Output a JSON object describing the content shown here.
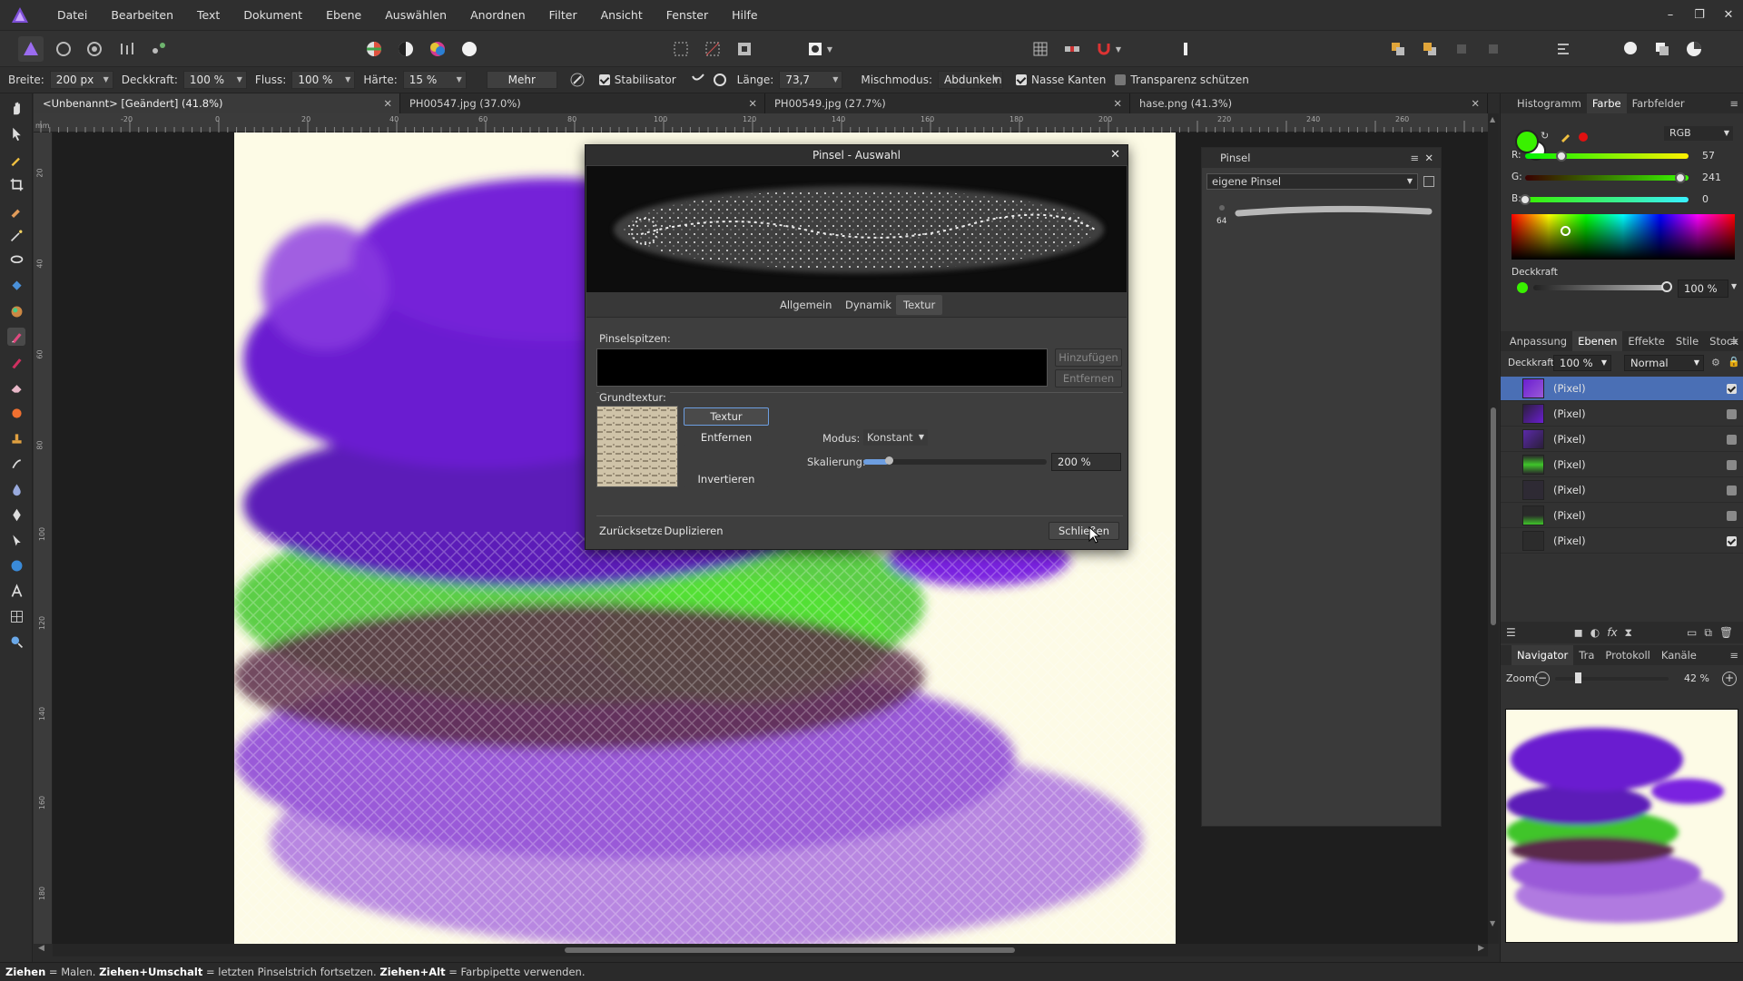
{
  "menu": [
    "Datei",
    "Bearbeiten",
    "Text",
    "Dokument",
    "Ebene",
    "Auswählen",
    "Anordnen",
    "Filter",
    "Ansicht",
    "Fenster",
    "Hilfe"
  ],
  "context": {
    "width_label": "Breite:",
    "width_value": "200 px",
    "opacity_label": "Deckkraft:",
    "opacity_value": "100 %",
    "flow_label": "Fluss:",
    "flow_value": "100 %",
    "hardness_label": "Härte:",
    "hardness_value": "15 %",
    "more": "Mehr",
    "stabilizer": "Stabilisator",
    "length_label": "Länge:",
    "length_value": "73,7",
    "blend_label": "Mischmodus:",
    "blend_value": "Abdunkeln",
    "wet_edges": "Nasse Kanten",
    "protect_alpha": "Transparenz schützen"
  },
  "tabs": [
    {
      "label": "<Unbenannt> [Geändert] (41.8%)"
    },
    {
      "label": "PH00547.jpg (37.0%)"
    },
    {
      "label": "PH00549.jpg (27.7%)"
    },
    {
      "label": "hase.png (41.3%)"
    }
  ],
  "ruler": {
    "h": [
      "-20",
      "0",
      "20",
      "40",
      "60",
      "80",
      "100",
      "120",
      "140",
      "160",
      "180",
      "200",
      "220",
      "240",
      "260"
    ],
    "v": [
      "mm",
      "20",
      "40",
      "60",
      "80",
      "100",
      "120",
      "140",
      "160",
      "180"
    ]
  },
  "brush_panel": {
    "title": "Pinsel",
    "category": "eigene Pinsel",
    "brush_size": "64"
  },
  "dialog": {
    "title": "Pinsel - Auswahl",
    "tabs": [
      "Allgemein",
      "Dynamik",
      "Textur"
    ],
    "tips_label": "Pinselspitzen:",
    "add": "Hinzufügen",
    "remove": "Entfernen",
    "base_texture_label": "Grundtextur:",
    "set_texture": "Textur festlegen",
    "remove_texture": "Entfernen",
    "invert": "Invertieren",
    "mode_label": "Modus:",
    "mode_value": "Konstant",
    "scale_label": "Skalierung:",
    "scale_value": "200 %",
    "scale_fraction": 0.14,
    "reset": "Zurücksetzen",
    "duplicate": "Duplizieren",
    "close": "Schließen"
  },
  "color_panel": {
    "tabs": [
      "Histogramm",
      "Farbe",
      "Farbfelder"
    ],
    "model": "RGB",
    "r_label": "R:",
    "r": "57",
    "r_fraction": 0.22,
    "g_label": "G:",
    "g": "241",
    "g_fraction": 0.95,
    "b_label": "B:",
    "b": "0",
    "b_fraction": 0.0,
    "opacity_label": "Deckkraft",
    "opacity_value": "100 %",
    "fg": "#39f100",
    "bg": "#ffffff",
    "accent": "#e01010"
  },
  "layers_panel": {
    "tabs": [
      "Anpassung",
      "Ebenen",
      "Effekte",
      "Stile",
      "Stock"
    ],
    "opacity_label": "Deckkraft:",
    "opacity_value": "100 %",
    "blend_value": "Normal",
    "layers": [
      {
        "name": "(Pixel)",
        "visible": true,
        "selected": true
      },
      {
        "name": "(Pixel)",
        "visible": false
      },
      {
        "name": "(Pixel)",
        "visible": false
      },
      {
        "name": "(Pixel)",
        "visible": false
      },
      {
        "name": "(Pixel)",
        "visible": false
      },
      {
        "name": "(Pixel)",
        "visible": false
      },
      {
        "name": "(Pixel)",
        "visible": true
      }
    ]
  },
  "navigator": {
    "tabs": [
      "Navigator",
      "Tra",
      "Protokoll",
      "Kanäle"
    ],
    "zoom_label": "Zoom:",
    "zoom_value": "42 %",
    "zoom_fraction": 0.2
  },
  "status": {
    "k1": "Ziehen",
    "t1": " = Malen. ",
    "k2": "Ziehen+Umschalt",
    "t2": " = letzten Pinselstrich fortsetzen. ",
    "k3": "Ziehen+Alt",
    "t3": " = Farbpipette verwenden."
  }
}
